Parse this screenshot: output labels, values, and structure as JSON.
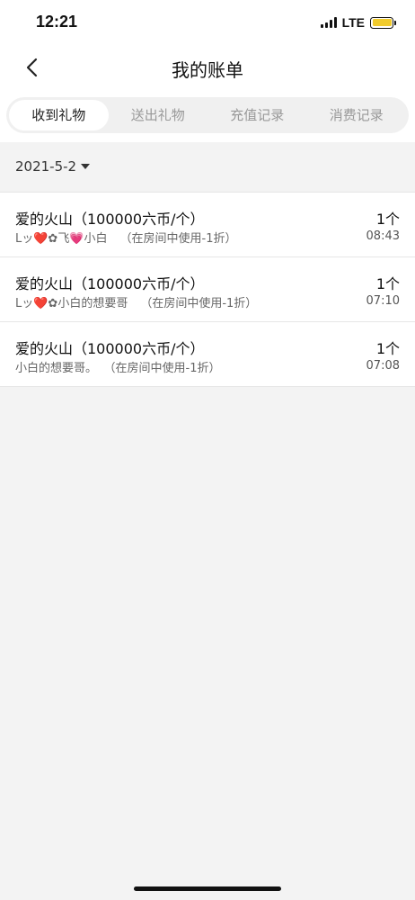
{
  "status_bar": {
    "time": "12:21",
    "network": "LTE",
    "battery_color": "#f1cb2c"
  },
  "header": {
    "title": "我的账单",
    "back_icon": "chevron-left-icon"
  },
  "tabs": [
    {
      "label": "收到礼物",
      "active": true
    },
    {
      "label": "送出礼物",
      "active": false
    },
    {
      "label": "充值记录",
      "active": false
    },
    {
      "label": "消费记录",
      "active": false
    }
  ],
  "filter": {
    "date": "2021-5-2",
    "icon": "caret-down-icon"
  },
  "records": [
    {
      "title": "爱的火山（100000六币/个）",
      "sender": "Lッ❤️✿飞💗小白",
      "note": "（在房间中使用-1折）",
      "count": "1个",
      "time": "08:43"
    },
    {
      "title": "爱的火山（100000六币/个）",
      "sender": "Lッ❤️✿小白的想要哥",
      "note": "（在房间中使用-1折）",
      "count": "1个",
      "time": "07:10"
    },
    {
      "title": "爱的火山（100000六币/个）",
      "sender": "小白的想要哥。",
      "note": "（在房间中使用-1折）",
      "count": "1个",
      "time": "07:08"
    }
  ]
}
